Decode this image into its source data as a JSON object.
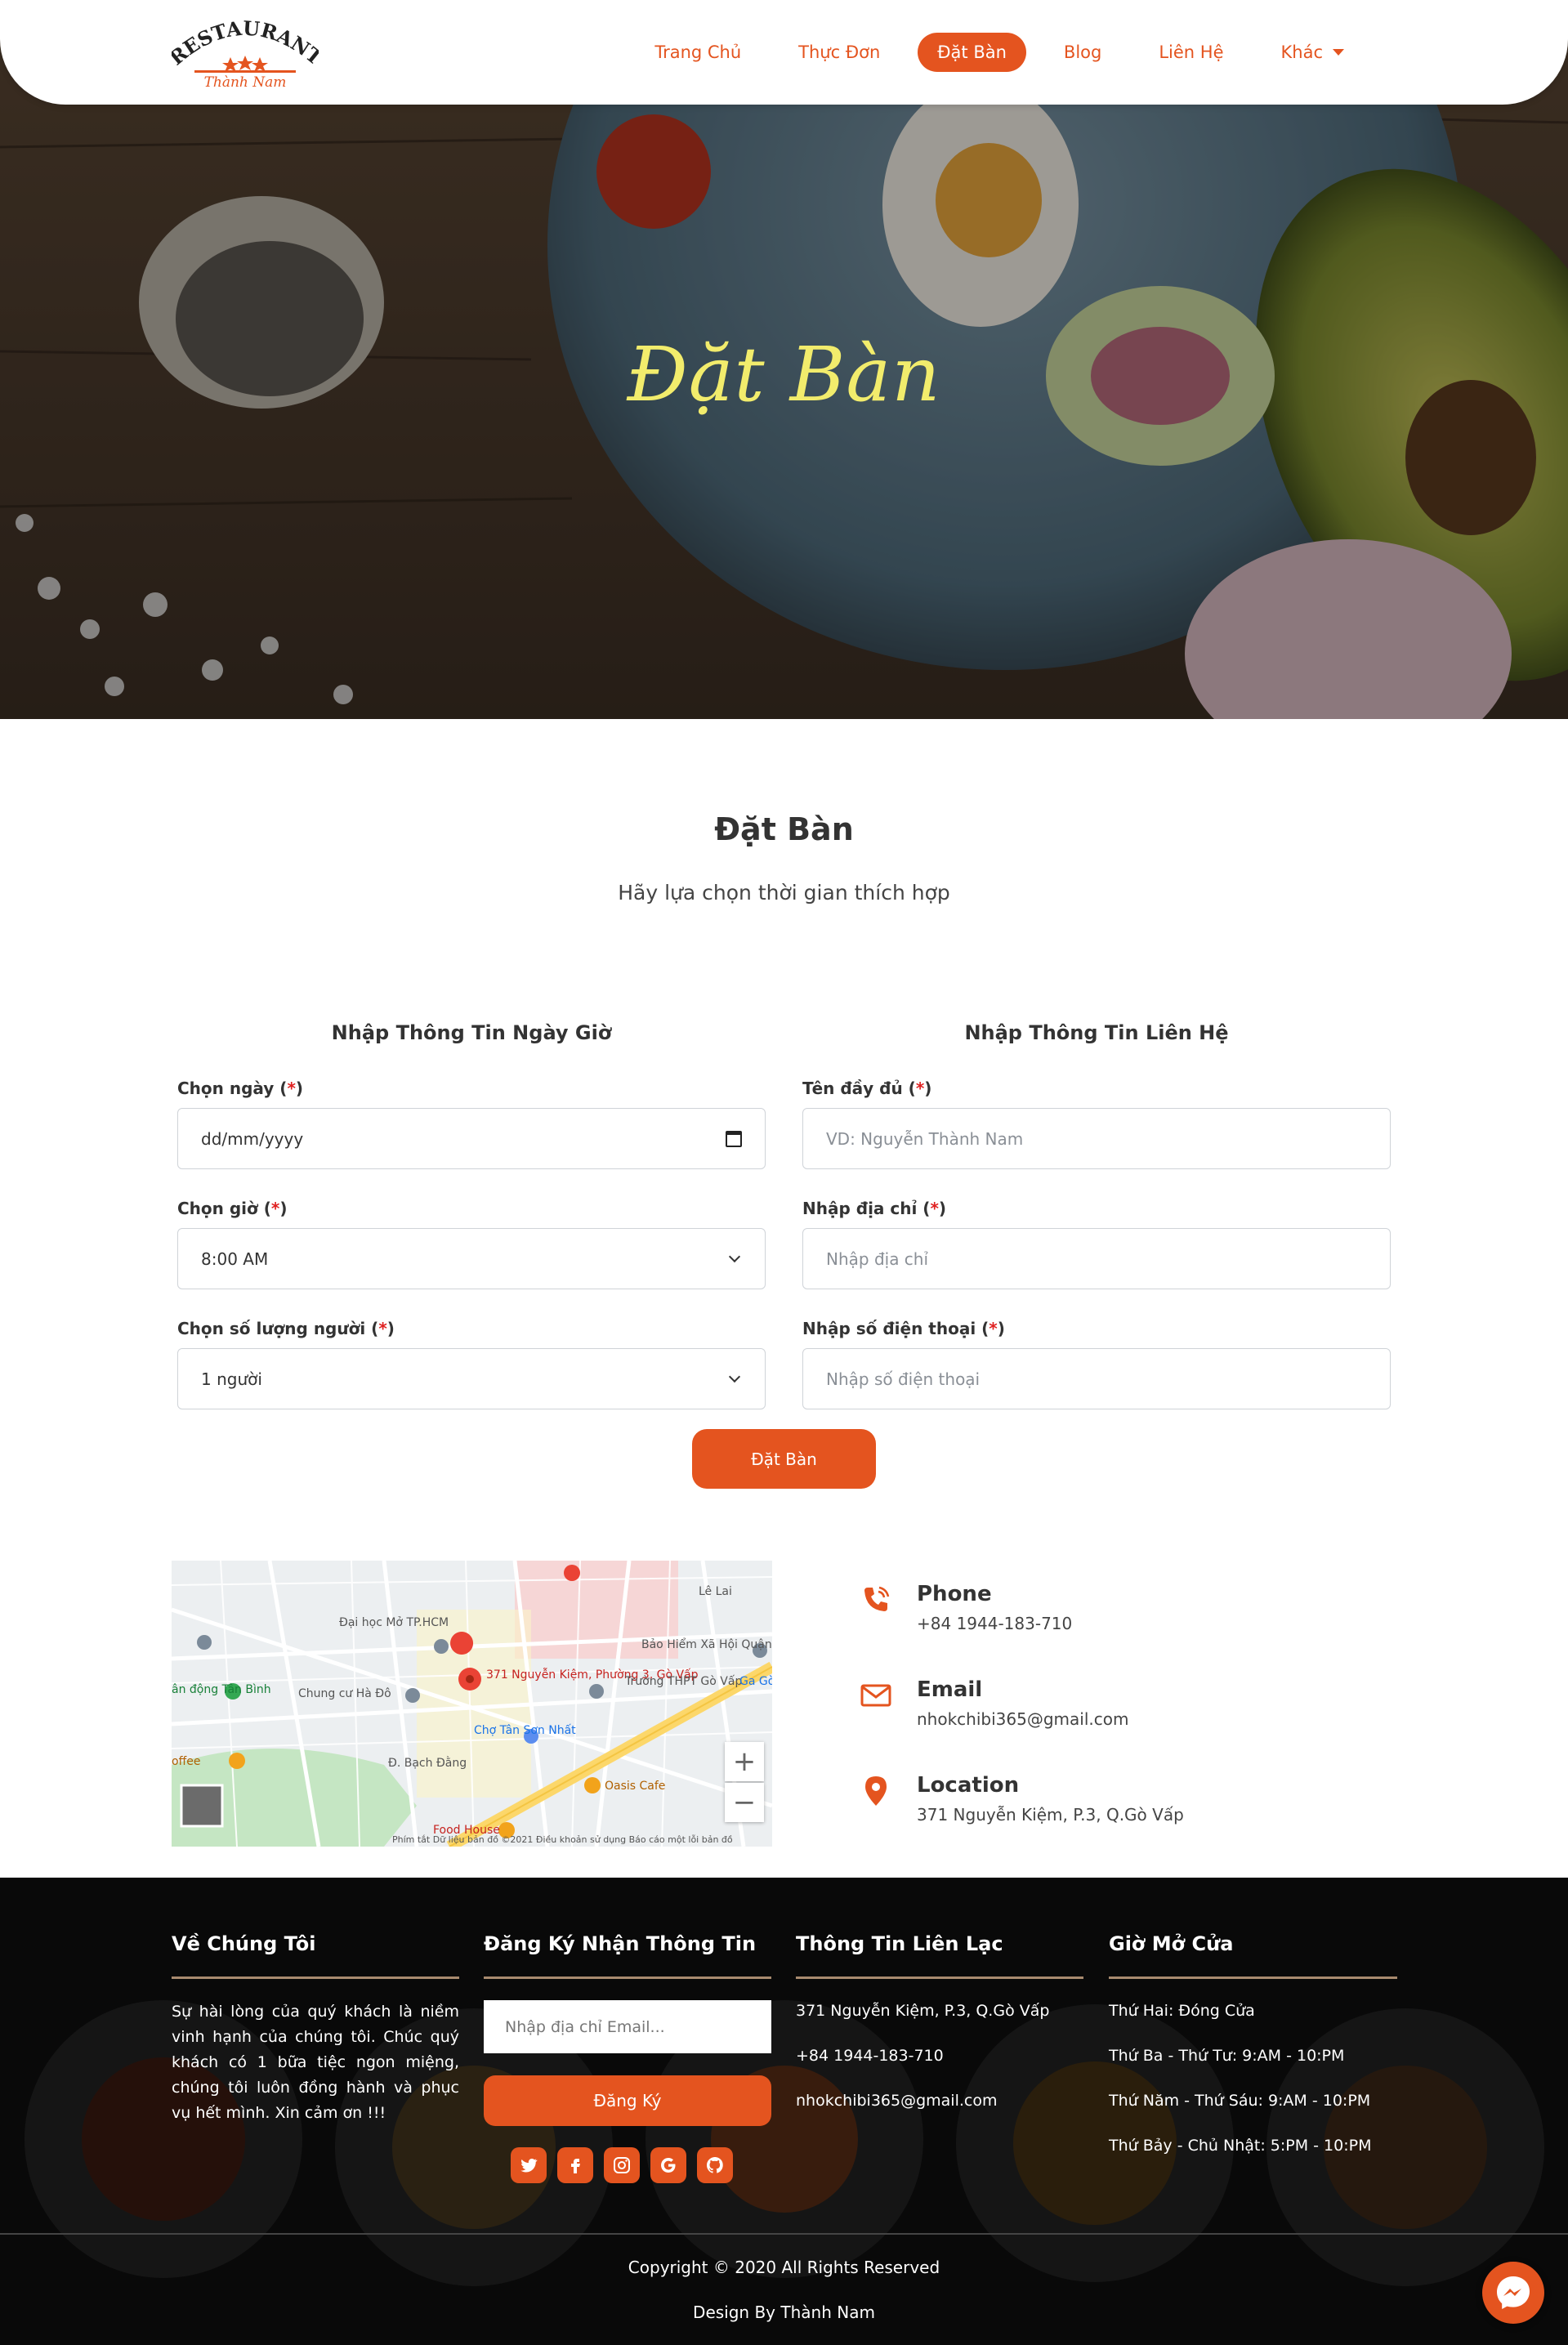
{
  "brand": {
    "logo_top": "RESTAURANT",
    "logo_bottom": "Thành Nam",
    "accent_color": "#e4541f"
  },
  "nav": {
    "items": [
      {
        "label": "Trang Chủ"
      },
      {
        "label": "Thực Đơn"
      },
      {
        "label": "Đặt Bàn"
      },
      {
        "label": "Blog"
      },
      {
        "label": "Liên Hệ"
      },
      {
        "label": "Khác"
      }
    ],
    "active_index": 2
  },
  "hero": {
    "title": "Đặt Bàn"
  },
  "intro": {
    "title": "Đặt Bàn",
    "subtitle": "Hãy lựa chọn thời gian thích hợp"
  },
  "form": {
    "left_heading": "Nhập Thông Tin Ngày Giờ",
    "right_heading": "Nhập Thông Tin Liên Hệ",
    "required_mark": "*",
    "date_label": "Chọn ngày",
    "date_placeholder": "dd/mm/yyyy",
    "time_label": "Chọn giờ",
    "time_value": "8:00 AM",
    "people_label": "Chọn số lượng người",
    "people_value": "1 người",
    "name_label": "Tên đầy đủ",
    "name_placeholder": "VD: Nguyễn Thành Nam",
    "address_label": "Nhập địa chỉ",
    "address_placeholder": "Nhập địa chỉ",
    "phone_label": "Nhập số điện thoại",
    "phone_placeholder": "Nhập số điện thoại",
    "submit_label": "Đặt Bàn"
  },
  "map": {
    "labels": [
      "Đại học Mở TP.HCM",
      "Bảo Hiểm Xã Hội Quận Gò Vấp",
      "Chung cư Hà Đô",
      "371 Nguyễn Kiệm, Phường 3, Gò Vấp",
      "Trường THPT Gò Vấp",
      "Chợ Tân Sơn Nhất",
      "Đ. Bạch Đằng",
      "Oasis Cafe",
      "Ga Gò V",
      "ân động Tân Bình",
      "offee",
      "Food House",
      "Lê Lai"
    ],
    "zoom_in": "+",
    "zoom_out": "−",
    "footer_text": "Phím tắt    Dữ liệu bản đồ ©2021    Điều khoản sử dụng    Báo cáo một lỗi bản đồ"
  },
  "contact": {
    "phone_title": "Phone",
    "phone_value": "+84 1944-183-710",
    "email_title": "Email",
    "email_value": "nhokchibi365@gmail.com",
    "location_title": "Location",
    "location_value": "371 Nguyễn Kiệm, P.3, Q.Gò Vấp"
  },
  "footer": {
    "about_title": "Về Chúng Tôi",
    "about_text": "Sự hài lòng của quý khách là niềm vinh hạnh của chúng tôi. Chúc quý khách có 1 bữa tiệc ngon miệng, chúng tôi luôn đồng hành và phục vụ hết mình. Xin cảm ơn !!!",
    "newsletter_title": "Đăng Ký Nhận Thông Tin",
    "email_placeholder": "Nhập địa chỉ Email...",
    "subscribe_label": "Đăng Ký",
    "social_icons": [
      "twitter-icon",
      "facebook-icon",
      "instagram-icon",
      "google-icon",
      "github-icon"
    ],
    "contact_title": "Thông Tin Liên Lạc",
    "contact_lines": [
      "371 Nguyễn Kiệm, P.3, Q.Gò Vấp",
      "+84 1944-183-710",
      "nhokchibi365@gmail.com"
    ],
    "hours_title": "Giờ Mở Cửa",
    "hours_lines": [
      "Thứ Hai: Đóng Cửa",
      "Thứ Ba - Thứ Tư: 9:AM - 10:PM",
      "Thứ Năm - Thứ Sáu: 9:AM - 10:PM",
      "Thứ Bảy - Chủ Nhật: 5:PM - 10:PM"
    ],
    "copyright": "Copyright © 2020 All Rights Reserved",
    "design_by": "Design By Thành Nam"
  }
}
